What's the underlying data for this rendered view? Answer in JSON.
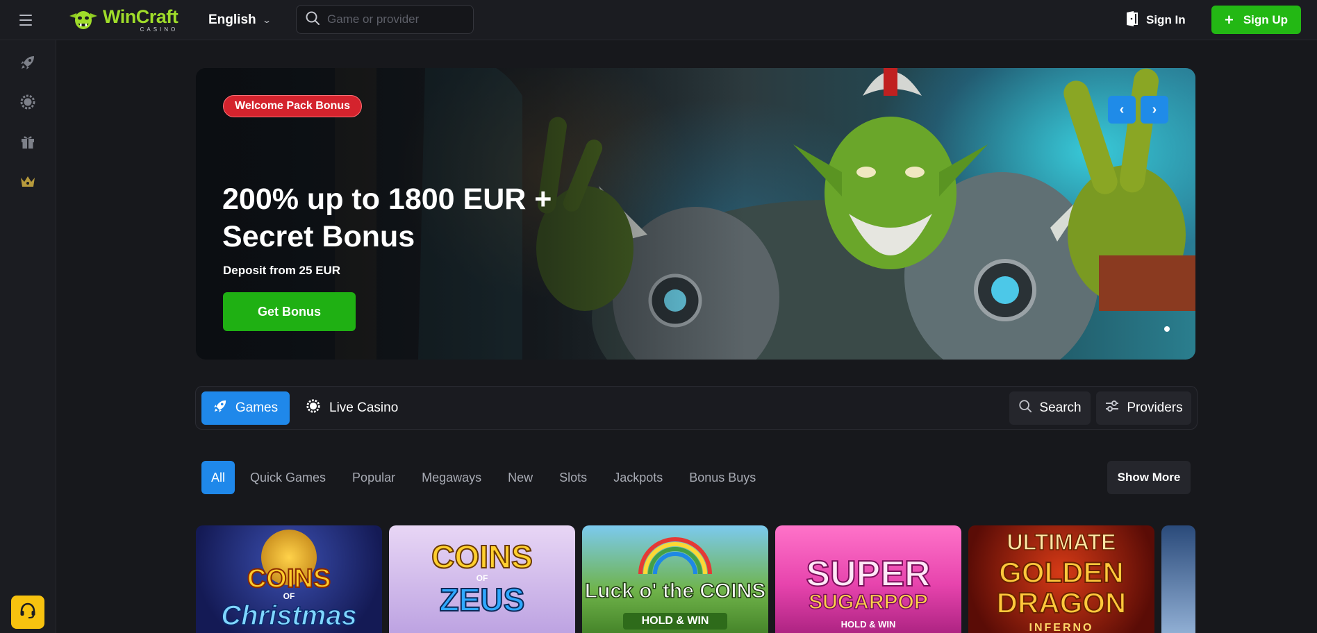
{
  "header": {
    "logo": {
      "main": "WinCraft",
      "sub": "CASINO"
    },
    "language": "English",
    "search_placeholder": "Game or provider",
    "signin_label": "Sign In",
    "signup_label": "Sign Up",
    "colors": {
      "accent_green": "#23b814",
      "logo_green": "#9fdc2a"
    }
  },
  "sidebar": {
    "items": [
      {
        "icon": "rocket-icon"
      },
      {
        "icon": "roulette-icon"
      },
      {
        "icon": "gift-icon"
      },
      {
        "icon": "crown-icon"
      }
    ],
    "support_icon": "headset-icon"
  },
  "hero": {
    "badge": "Welcome Pack Bonus",
    "title": "200% up to 1800 EUR + Secret Bonus",
    "subtitle": "Deposit from 25 EUR",
    "cta": "Get Bonus",
    "prev": "‹",
    "next": "›"
  },
  "categories": {
    "games": "Games",
    "live_casino": "Live Casino",
    "search": "Search",
    "providers": "Providers"
  },
  "filters": {
    "tabs": [
      "All",
      "Quick Games",
      "Popular",
      "Megaways",
      "New",
      "Slots",
      "Jackpots",
      "Bonus Buys"
    ],
    "active": "All",
    "show_more": "Show More"
  },
  "games": [
    {
      "title_1": "COINS",
      "title_2": "OF",
      "title_3": "Christmas"
    },
    {
      "title_1": "COINS",
      "title_2": "OF",
      "title_3": "ZEUS"
    },
    {
      "title_1": "Luck o' the COINS",
      "title_2": "HOLD & WIN",
      "title_3": ""
    },
    {
      "title_1": "SUPER",
      "title_2": "SUGARPOP",
      "title_3": "HOLD & WIN"
    },
    {
      "title_1": "ULTIMATE",
      "title_2": "GOLDEN DRAGON",
      "title_3": "INFERNO"
    }
  ]
}
